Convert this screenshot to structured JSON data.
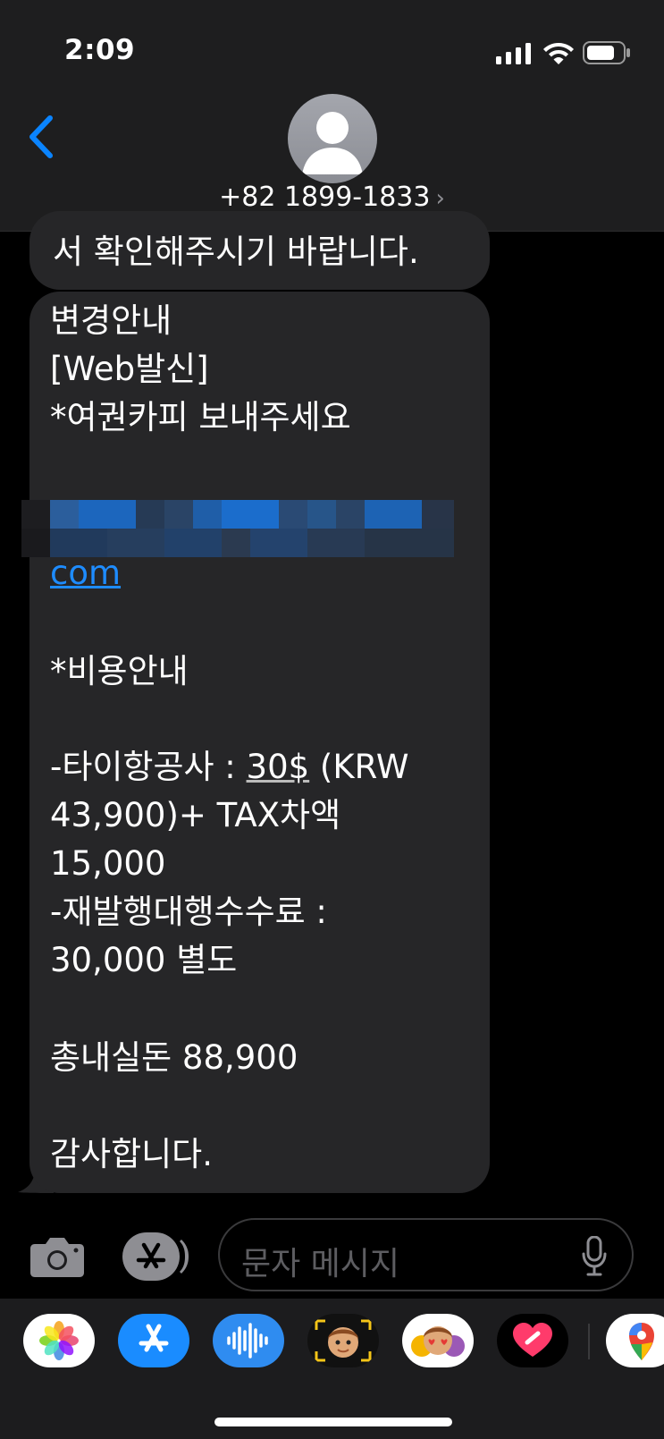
{
  "status_bar": {
    "time": "2:09"
  },
  "header": {
    "contact_number": "+82 1899-1833",
    "chevron": "›"
  },
  "messages": {
    "previous_tail": "서 확인해주시기 바랍니다.",
    "main": {
      "line1": "변경안내",
      "line2": "[Web발신]",
      "line3": "*여권카피 보내주세요",
      "link_tail": "com",
      "cost_title": "*비용안내",
      "fee1_prefix": "-타이항공사 : ",
      "fee1_usd": "30$",
      "fee1_suffix": " (KRW",
      "fee1_line2": "43,900)+ TAX차액",
      "fee1_line3": "15,000",
      "fee2_line1": "-재발행대행수수료 :",
      "fee2_line2": "30,000 별도",
      "total": "총내실돈 88,900",
      "closing": "감사합니다."
    }
  },
  "input": {
    "placeholder": "문자 메시지"
  },
  "icons": [
    "back-chevron-icon",
    "avatar-icon",
    "signal-icon",
    "wifi-icon",
    "battery-icon",
    "camera-icon",
    "app-store-icon",
    "microphone-icon",
    "photos-app-icon",
    "app-store-app-icon",
    "audio-message-app-icon",
    "memoji-app-icon",
    "memoji-stickers-app-icon",
    "digital-touch-app-icon",
    "google-maps-app-icon"
  ],
  "colors": {
    "bubble": "#262628",
    "link": "#1e8cff",
    "header": "#1e1e1f",
    "accent": "#0a84ff"
  }
}
